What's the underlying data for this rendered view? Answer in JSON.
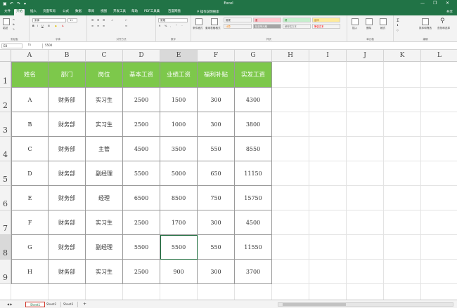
{
  "app": {
    "title": "Excel",
    "window_controls": [
      "—",
      "❐",
      "✕"
    ]
  },
  "ribbon_tabs": [
    "文件",
    "开始",
    "插入",
    "页面布局",
    "公式",
    "数据",
    "审阅",
    "视图",
    "开发工具",
    "帮助",
    "PDF工具集",
    "百度网盘"
  ],
  "active_tab_index": 1,
  "tell_me": "操作说明搜索",
  "share_label": "共享",
  "ribbon": {
    "font_name": "宋体",
    "font_size": "11",
    "number_format": "常规",
    "groups": [
      "剪贴板",
      "字体",
      "对齐方式",
      "数字",
      "样式",
      "单元格",
      "编辑"
    ],
    "styles": [
      {
        "label": "常规",
        "bg": "#ffffff",
        "fg": "#333333"
      },
      {
        "label": "差",
        "bg": "#ffc7ce",
        "fg": "#9c0006"
      },
      {
        "label": "好",
        "bg": "#c6efce",
        "fg": "#006100"
      },
      {
        "label": "适中",
        "bg": "#ffeb9c",
        "fg": "#9c5700"
      },
      {
        "label": "计算",
        "bg": "#f2f2f2",
        "fg": "#fa7d00"
      },
      {
        "label": "检查单元格",
        "bg": "#a5a5a5",
        "fg": "#ffffff"
      },
      {
        "label": "解释性文本",
        "bg": "#ffffff",
        "fg": "#7f7f7f"
      },
      {
        "label": "警告文本",
        "bg": "#ffffff",
        "fg": "#ff0000"
      }
    ],
    "buttons": {
      "paste": "粘贴",
      "cond_format": "条件格式",
      "as_table": "套用表格格式",
      "insert": "插入",
      "delete": "删除",
      "format": "格式",
      "sort_filter": "排序和筛选",
      "find_select": "查找和选择"
    }
  },
  "formula_bar": {
    "name_box": "E8",
    "fx_label": "fx",
    "formula": "5500"
  },
  "grid": {
    "column_headers": [
      "A",
      "B",
      "C",
      "D",
      "E",
      "F",
      "G",
      "H",
      "I",
      "J",
      "K",
      "L"
    ],
    "row_headers": [
      "1",
      "2",
      "3",
      "4",
      "5",
      "6",
      "7",
      "8",
      "9"
    ],
    "selected_column": "E",
    "selected_row": "8",
    "table_headers": [
      "姓名",
      "部门",
      "岗位",
      "基本工资",
      "业绩工资",
      "福利补贴",
      "实发工资"
    ],
    "rows": [
      [
        "A",
        "财务部",
        "实习生",
        "2500",
        "1500",
        "300",
        "4300"
      ],
      [
        "B",
        "财务部",
        "实习生",
        "2500",
        "1000",
        "300",
        "3800"
      ],
      [
        "C",
        "财务部",
        "主管",
        "4500",
        "3500",
        "550",
        "8550"
      ],
      [
        "D",
        "财务部",
        "副经理",
        "5500",
        "5000",
        "650",
        "11150"
      ],
      [
        "E",
        "财务部",
        "经理",
        "6500",
        "8500",
        "750",
        "15750"
      ],
      [
        "F",
        "财务部",
        "实习生",
        "2500",
        "1700",
        "300",
        "4500"
      ],
      [
        "G",
        "财务部",
        "副经理",
        "5500",
        "5500",
        "550",
        "11550"
      ],
      [
        "H",
        "财务部",
        "实习生",
        "2500",
        "900",
        "300",
        "3700"
      ]
    ],
    "header_color": "#7dc84b"
  },
  "sheets": [
    "Sheet1",
    "Sheet2",
    "Sheet3"
  ],
  "active_sheet_index": 0,
  "add_sheet": "+"
}
